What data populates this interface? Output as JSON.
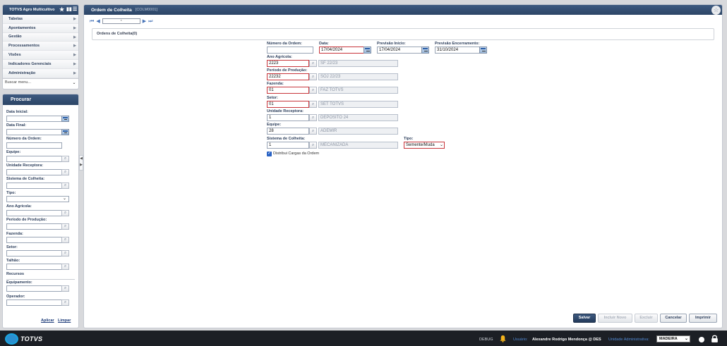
{
  "app": {
    "title": "TOTVS Agro Multicultivo"
  },
  "nav": {
    "items": [
      {
        "label": "Tabelas"
      },
      {
        "label": "Apontamentos"
      },
      {
        "label": "Gestão"
      },
      {
        "label": "Processamentos"
      },
      {
        "label": "Visões"
      },
      {
        "label": "Indicadores Gerenciais"
      },
      {
        "label": "Administração"
      }
    ],
    "search_placeholder": "Buscar menu..."
  },
  "procurar": {
    "title": "Procurar",
    "fields": {
      "data_inicial": "Data Inicial:",
      "data_final": "Data Final:",
      "numero_ordem": "Número da Ordem:",
      "equipe": "Equipe:",
      "unidade_receptora": "Unidade Receptora:",
      "sistema_colheita": "Sistema de Colheita:",
      "tipo": "Tipo:",
      "ano_agricola": "Ano Agrícola:",
      "periodo_producao": "Período de Produção:",
      "fazenda": "Fazenda:",
      "setor": "Setor:",
      "talhao": "Talhão:",
      "recursos": "Recursos",
      "equipamento": "Equipamento:",
      "operador": "Operador:"
    },
    "aplicar": "Aplicar",
    "limpar": "Limpar"
  },
  "main": {
    "title": "Ordem de Colheita",
    "subtitle": "[COLM0001]",
    "page_value": "*",
    "subpanel_title": "Ordens de Colheita(0)"
  },
  "form": {
    "numero_ordem": {
      "label": "Número da Ordem:",
      "value": ""
    },
    "data": {
      "label": "Data:",
      "value": "17/04/2024"
    },
    "previsao_inicio": {
      "label": "Previsão Início:",
      "value": "17/04/2024"
    },
    "previsao_encerramento": {
      "label": "Previsão Encerramento:",
      "value": "31/10/2024"
    },
    "ano_agricola": {
      "label": "Ano Agrícola:",
      "code": "2223",
      "desc": "SF 22/23"
    },
    "periodo_producao": {
      "label": "Período de Produção:",
      "code": "22232",
      "desc": "SOJ 22/23"
    },
    "fazenda": {
      "label": "Fazenda:",
      "code": "01",
      "desc": "FAZ TOTVS"
    },
    "setor": {
      "label": "Setor:",
      "code": "01",
      "desc": "SET TOTVS"
    },
    "unidade_receptora": {
      "label": "Unidade Receptora:",
      "code": "1",
      "desc": "DEPOSITO 24"
    },
    "equipe": {
      "label": "Equipe:",
      "code": "28",
      "desc": "ADEMIR"
    },
    "sistema_colheita": {
      "label": "Sistema de Colheita:",
      "code": "1",
      "desc": "MECANIZADA"
    },
    "tipo": {
      "label": "Tipo:",
      "value": "Semente/Muda"
    },
    "distribui": {
      "label": "Distribui Cargas da Ordem",
      "checked": true
    }
  },
  "buttons": {
    "salvar": "Salvar",
    "incluir_novo": "Incluir Novo",
    "excluir": "Excluir",
    "cancelar": "Cancelar",
    "imprimir": "Imprimir"
  },
  "statusbar": {
    "logo": "TOTVS",
    "debug": "DEBUG",
    "usuario_label": "Usuário:",
    "usuario_value": "Alexandre Rodrigo Mendonça @ DES",
    "unidade_label": "Unidade Administrativa:",
    "unidade_value": "MADEIRA"
  },
  "colors": {
    "header": "#2c4566",
    "required_border": "#c7353b",
    "accent": "#2a63c4"
  }
}
